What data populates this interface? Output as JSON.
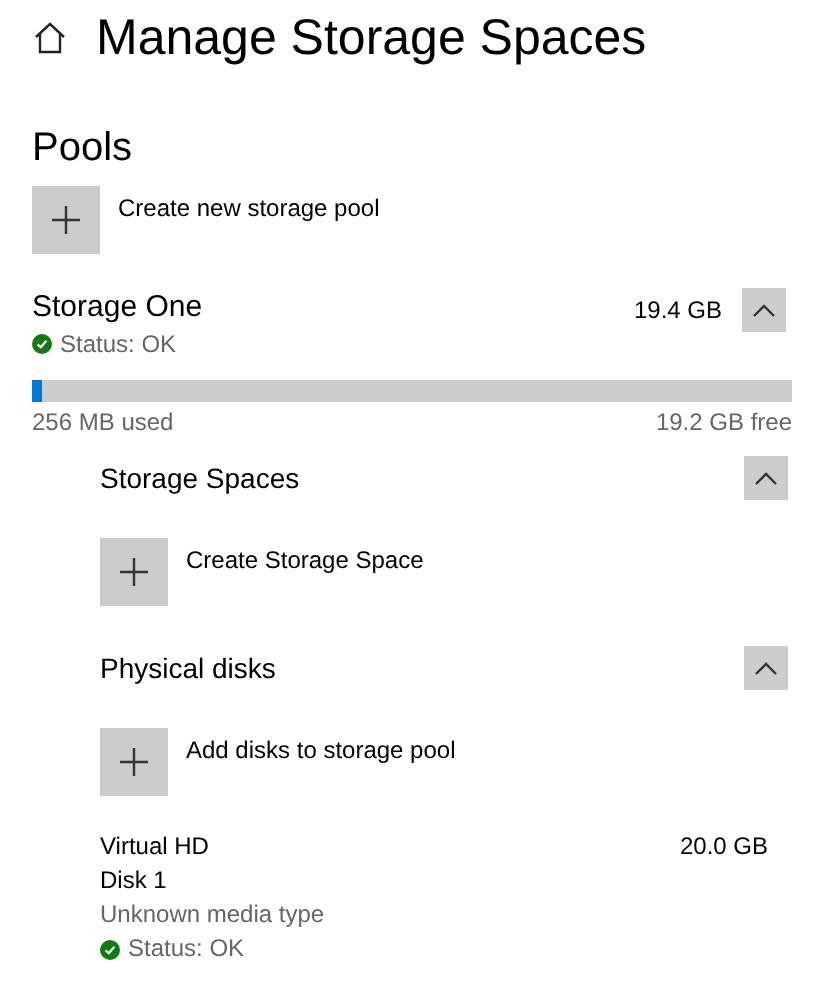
{
  "page_title": "Manage Storage Spaces",
  "pools_heading": "Pools",
  "create_pool": {
    "label": "Create new storage pool"
  },
  "pool": {
    "name": "Storage One",
    "size": "19.4 GB",
    "expanded": true,
    "status": "Status: OK",
    "status_ok": true,
    "level": 0.013,
    "used": "256 MB used",
    "free": "19.2 GB free",
    "sections": [
      {
        "heading": "Storage Spaces",
        "expanded": true,
        "action": "Create Storage Space"
      },
      {
        "heading": "Physical disks",
        "expanded": true,
        "action": "Add disks to storage pool",
        "disks": [
          {
            "name": "Virtual HD",
            "size": "20.0 GB",
            "label": "Disk 1",
            "media": "Unknown media type",
            "status": "Status: OK",
            "status_ok": true
          }
        ]
      }
    ]
  }
}
